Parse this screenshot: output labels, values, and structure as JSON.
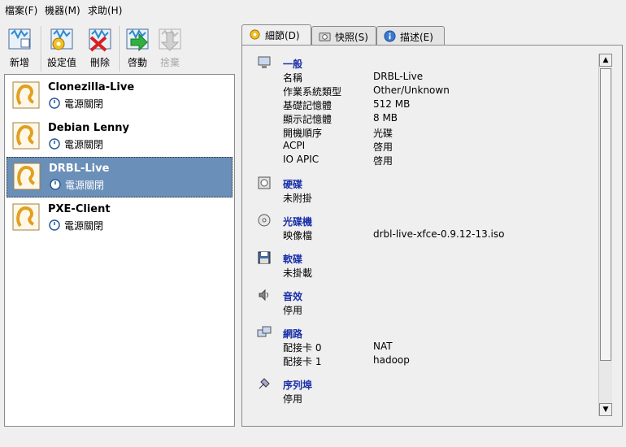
{
  "menu": [
    "檔案(F)",
    "機器(M)",
    "求助(H)"
  ],
  "toolbar": {
    "new": "新增",
    "settings": "設定值",
    "delete": "刪除",
    "start": "啓動",
    "discard": "捨棄"
  },
  "vms": [
    {
      "name": "Clonezilla-Live",
      "state": "電源關閉"
    },
    {
      "name": "Debian Lenny",
      "state": "電源關閉"
    },
    {
      "name": "DRBL-Live",
      "state": "電源關閉"
    },
    {
      "name": "PXE-Client",
      "state": "電源關閉"
    }
  ],
  "tabs": [
    "細節(D)",
    "快照(S)",
    "描述(E)"
  ],
  "details": {
    "general": {
      "title": "一般",
      "rows": [
        {
          "k": "名稱",
          "v": "DRBL-Live"
        },
        {
          "k": "作業系統類型",
          "v": "Other/Unknown"
        },
        {
          "k": "基礎記憶體",
          "v": "512 MB"
        },
        {
          "k": "顯示記憶體",
          "v": "8 MB"
        },
        {
          "k": "開機順序",
          "v": "光碟"
        },
        {
          "k": "ACPI",
          "v": "啓用"
        },
        {
          "k": "IO APIC",
          "v": "啓用"
        }
      ]
    },
    "hdd": {
      "title": "硬碟",
      "rows": [
        {
          "k": "未附掛",
          "v": ""
        }
      ]
    },
    "cd": {
      "title": "光碟機",
      "rows": [
        {
          "k": "映像檔",
          "v": "drbl-live-xfce-0.9.12-13.iso"
        }
      ]
    },
    "floppy": {
      "title": "軟碟",
      "rows": [
        {
          "k": "未掛載",
          "v": ""
        }
      ]
    },
    "audio": {
      "title": "音效",
      "rows": [
        {
          "k": "停用",
          "v": ""
        }
      ]
    },
    "network": {
      "title": "網路",
      "rows": [
        {
          "k": "配接卡 0",
          "v": "NAT"
        },
        {
          "k": "配接卡 1",
          "v": "hadoop"
        }
      ]
    },
    "serial": {
      "title": "序列埠",
      "rows": [
        {
          "k": "停用",
          "v": ""
        }
      ]
    }
  }
}
